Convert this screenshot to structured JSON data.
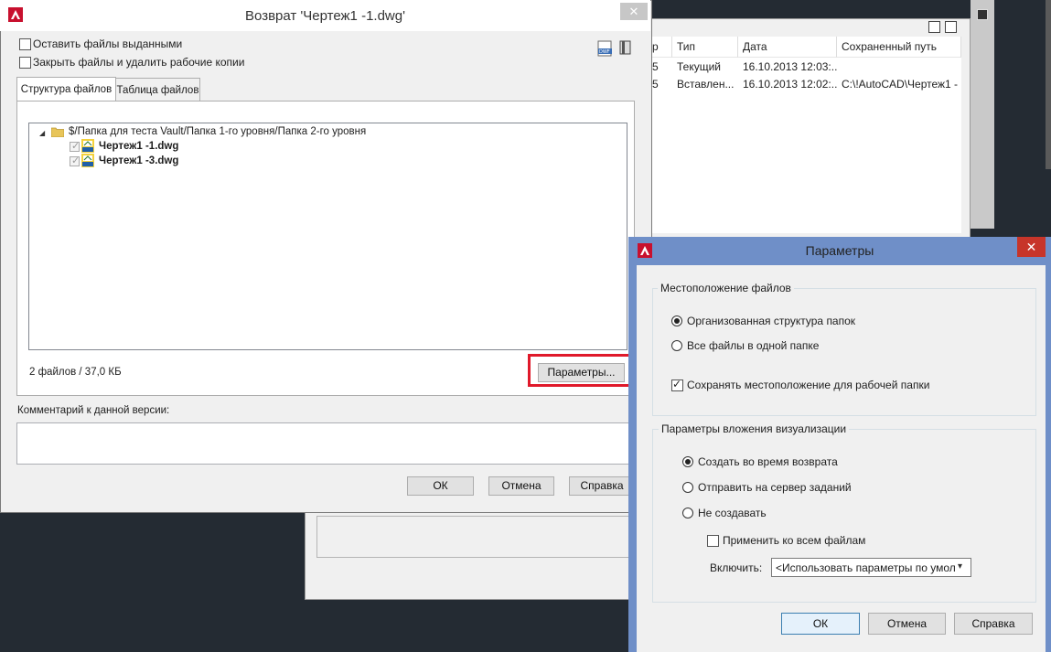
{
  "background_window": {
    "columns": [
      "р",
      "Тип",
      "Дата",
      "Сохраненный путь"
    ],
    "rows": [
      [
        "5",
        "Текущий",
        "16.10.2013 12:03:...",
        ""
      ],
      [
        "5",
        "Вставлен...",
        "16.10.2013 12:02:...",
        "C:\\!AutoCAD\\Чертеж1 -"
      ]
    ],
    "icons": [
      "list-view-icon",
      "tree-view-icon",
      "panel-icon"
    ]
  },
  "main_dialog": {
    "title": "Возврат 'Чертеж1 -1.dwg'",
    "close_label": "✕",
    "checkboxes": [
      {
        "label": "Оставить файлы выданными",
        "checked": false
      },
      {
        "label": "Закрыть файлы и удалить рабочие копии",
        "checked": false
      }
    ],
    "toolbar_icons": [
      "dwf-icon",
      "book-icon"
    ],
    "tabs": [
      {
        "label": "Структура файлов",
        "active": true
      },
      {
        "label": "Таблица файлов",
        "active": false
      }
    ],
    "tree": {
      "folder": "$/Папка для теста Vault/Папка 1-го уровня/Папка 2-го уровня",
      "files": [
        {
          "name": "Чертеж1 -1.dwg",
          "checked": true
        },
        {
          "name": "Чертеж1 -3.dwg",
          "checked": true
        }
      ]
    },
    "summary": "2 файлов / 37,0 КБ",
    "params_button": "Параметры...",
    "comment_label": "Комментарий к данной версии:",
    "comment_value": "",
    "buttons": {
      "ok": "ОК",
      "cancel": "Отмена",
      "help": "Справка"
    }
  },
  "params_dialog": {
    "title": "Параметры",
    "close_label": "✕",
    "group_location": {
      "label": "Местоположение файлов",
      "options": [
        {
          "label": "Организованная структура папок",
          "selected": true
        },
        {
          "label": "Все файлы в одной папке",
          "selected": false
        }
      ],
      "keep_location": {
        "label": "Сохранять местоположение для рабочей папки",
        "checked": true
      }
    },
    "group_visual": {
      "label": "Параметры вложения визуализации",
      "options": [
        {
          "label": "Создать во время возврата",
          "selected": true
        },
        {
          "label": "Отправить на сервер заданий",
          "selected": false
        },
        {
          "label": "Не создавать",
          "selected": false
        }
      ],
      "apply_all": {
        "label": "Применить ко всем файлам",
        "checked": false
      },
      "include_label": "Включить:",
      "include_value": "<Использовать параметры по умол"
    },
    "buttons": {
      "ok": "ОК",
      "cancel": "Отмена",
      "help": "Справка"
    }
  },
  "colors": {
    "accent_blue": "#6f8fc8",
    "highlight_red": "#e0192a",
    "close_red": "#c7352a"
  }
}
